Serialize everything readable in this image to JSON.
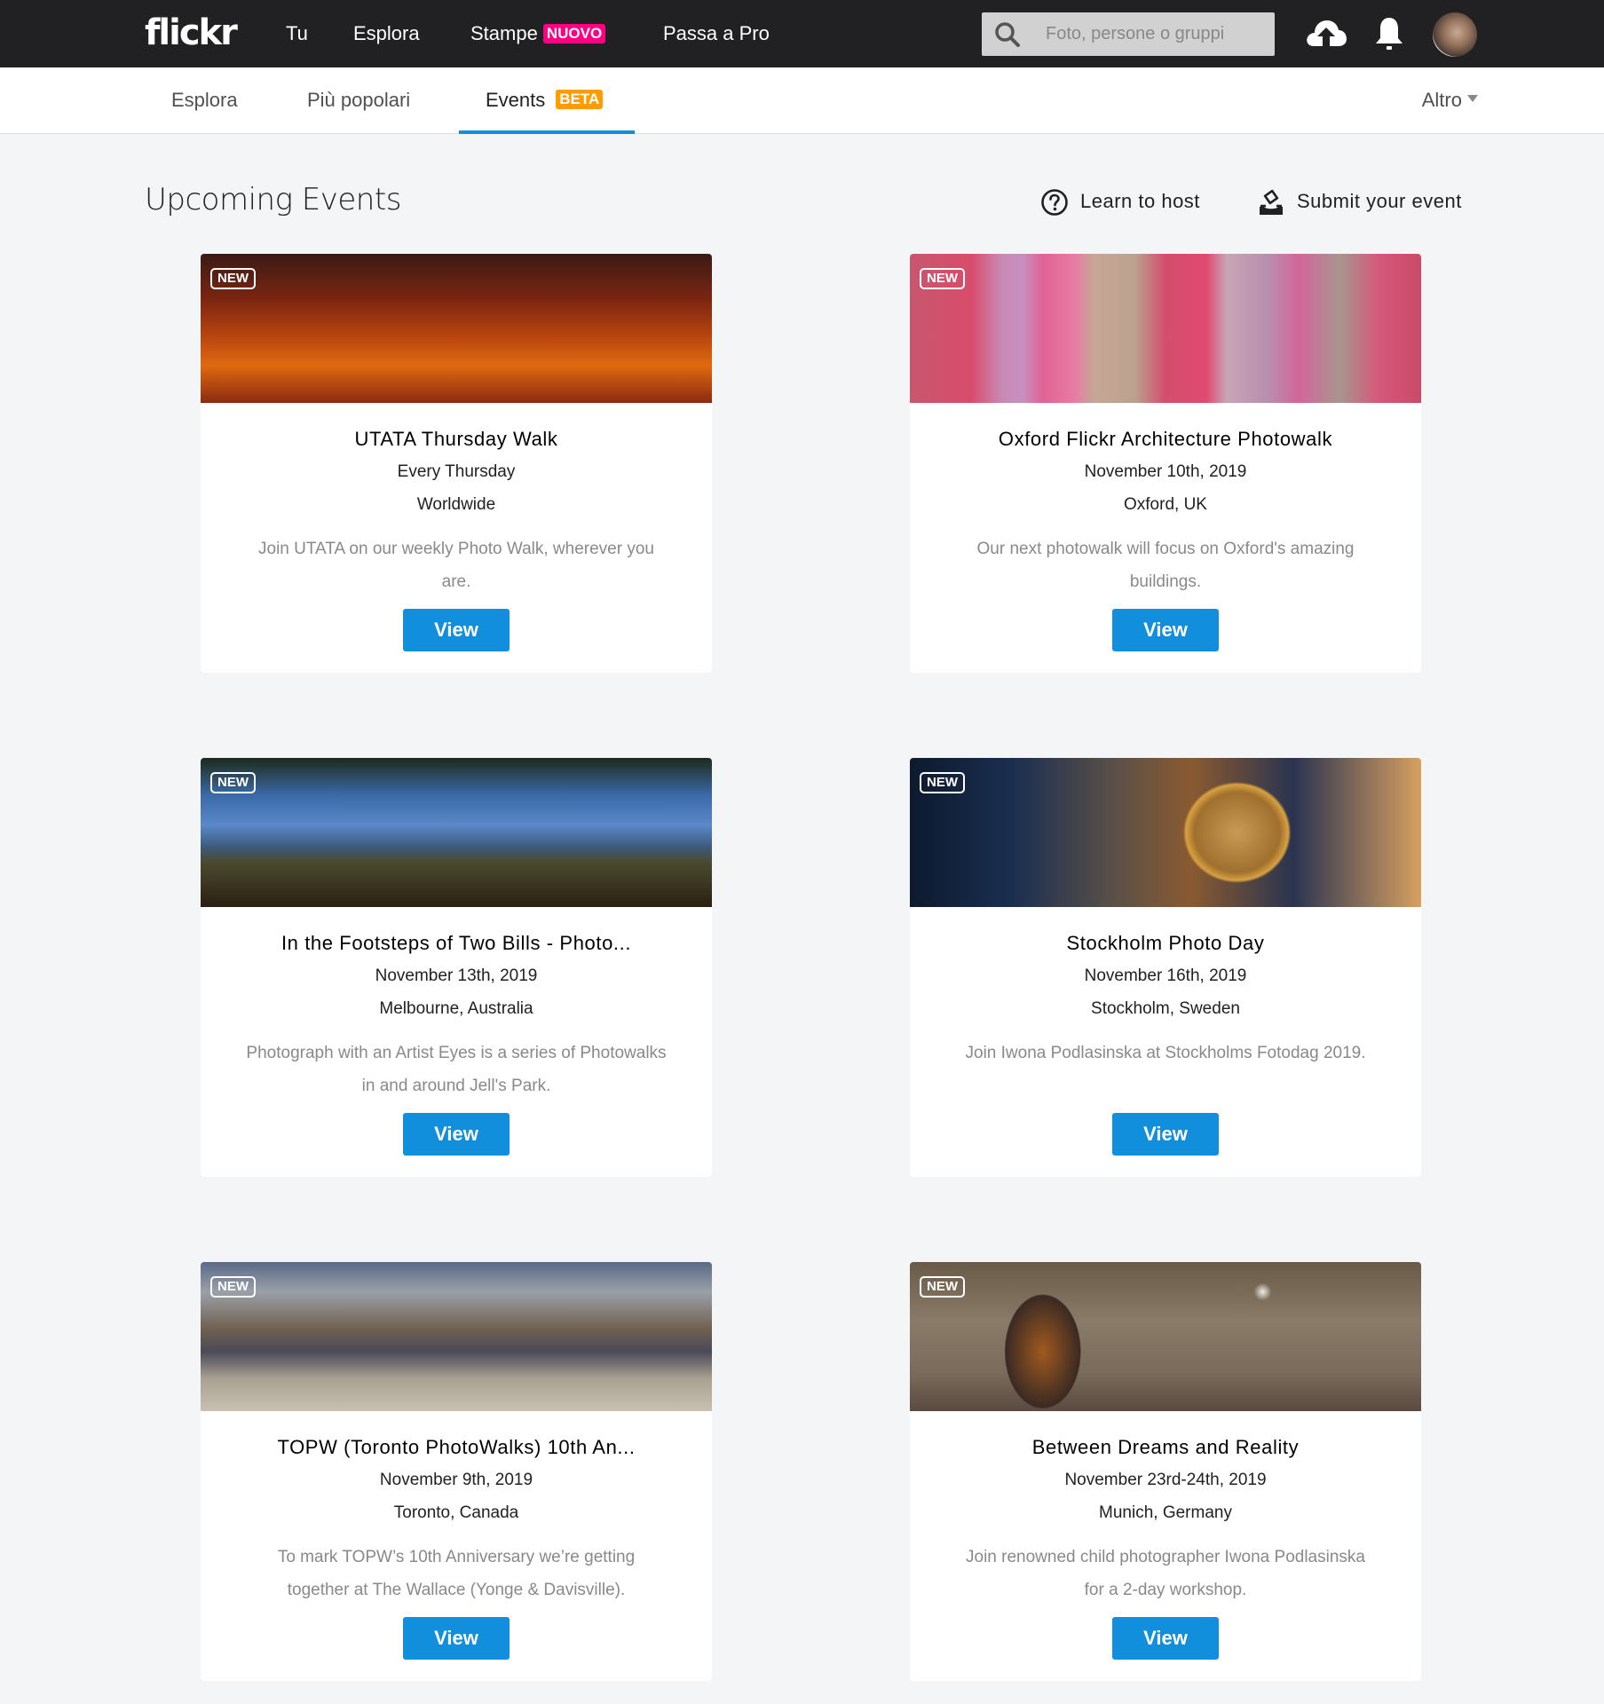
{
  "header": {
    "logo": "flickr",
    "nav": [
      {
        "label": "Tu"
      },
      {
        "label": "Esplora"
      },
      {
        "label": "Stampe",
        "badge": "NUOVO"
      },
      {
        "label": "Passa a Pro"
      }
    ],
    "search": {
      "placeholder": "Foto, persone o gruppi",
      "value": ""
    },
    "icons": [
      "upload-icon",
      "bell-icon",
      "avatar"
    ]
  },
  "subnav": {
    "items": [
      {
        "label": "Esplora"
      },
      {
        "label": "Più popolari"
      },
      {
        "label": "Events",
        "badge": "BETA",
        "active": true
      }
    ],
    "more_label": "Altro"
  },
  "page": {
    "title": "Upcoming Events",
    "learn_label": "Learn to host",
    "submit_label": "Submit your event"
  },
  "colors": {
    "header_bg": "#212124",
    "accent_blue": "#128fdc",
    "badge_nuovo": "#ff0084",
    "badge_beta": "#ff9c00",
    "page_bg": "#f3f5f6"
  },
  "events": [
    {
      "badge": "NEW",
      "title": "UTATA Thursday Walk",
      "date": "Every Thursday",
      "location": "Worldwide",
      "description": "Join UTATA on our weekly Photo Walk, wherever you are.",
      "button": "View",
      "image": "sunset clouds"
    },
    {
      "badge": "NEW",
      "title": "Oxford Flickr Architecture Photowalk",
      "date": "November 10th, 2019",
      "location": "Oxford, UK",
      "description": "Our next photowalk will focus on Oxford's amazing buildings.",
      "button": "View",
      "image": "pink architecture facade"
    },
    {
      "badge": "NEW",
      "title": "In the Footsteps of Two Bills - Photo...",
      "date": "November 13th, 2019",
      "location": "Melbourne, Australia",
      "description": "Photograph with an Artist Eyes is a series of Photowalks in and around Jell's Park.",
      "button": "View",
      "image": "park landscape with trees"
    },
    {
      "badge": "NEW",
      "title": "Stockholm Photo Day",
      "date": "November 16th, 2019",
      "location": "Stockholm, Sweden",
      "description": "Join Iwona Podlasinska at Stockholms Fotodag 2019.",
      "button": "View",
      "image": "child with magnifying glass"
    },
    {
      "badge": "NEW",
      "title": "TOPW (Toronto PhotoWalks) 10th An...",
      "date": "November 9th, 2019",
      "location": "Toronto, Canada",
      "description": "To mark TOPW’s 10th Anniversary we’re getting together at The Wallace (Yonge & Davisville).",
      "button": "View",
      "image": "photographers at old building"
    },
    {
      "badge": "NEW",
      "title": "Between Dreams and Reality",
      "date": "November 23rd-24th, 2019",
      "location": "Munich, Germany",
      "description": "Join renowned child photographer Iwona Podlasinska for a 2-day workshop.",
      "button": "View",
      "image": "boy holding hat in street"
    }
  ]
}
